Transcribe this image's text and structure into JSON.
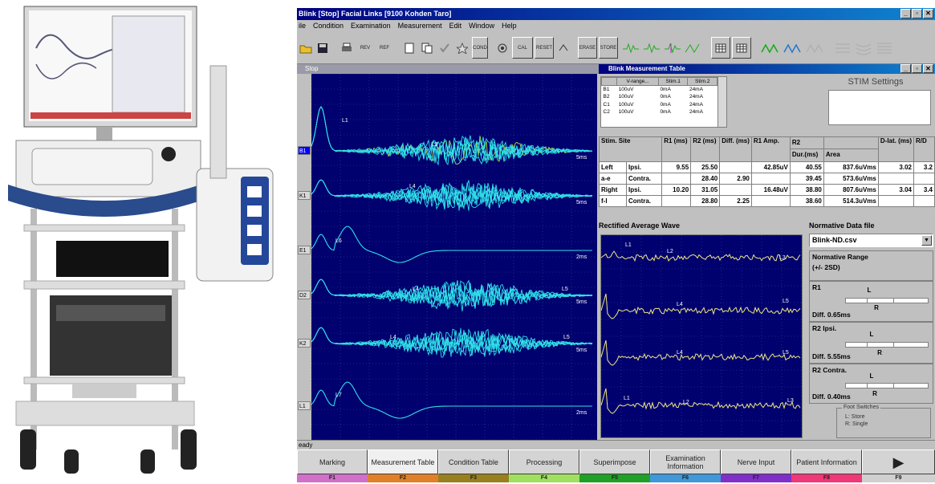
{
  "window": {
    "title": "Blink  [Stop]  Facial  Links [9100  Kohden  Taro]",
    "min": "_",
    "max": "▫",
    "close": "✕"
  },
  "menu": [
    "ile",
    "Condition",
    "Examination",
    "Measurement",
    "Edit",
    "Window",
    "Help"
  ],
  "toolbar": {
    "rev_label": "REV",
    "ref_label": "REF",
    "cond_label": "COND",
    "cal_label": "CAL",
    "reset_label": "RESET",
    "erase_label": "ERASE",
    "store_label": "STORE",
    "meas_label": "MEAS"
  },
  "wave_window": {
    "title": "Stop",
    "channels": [
      "B1",
      "K1",
      "E1",
      "D2",
      "K2",
      "L1"
    ],
    "selected_channel": "B1",
    "scales": [
      "5ms",
      "5ms",
      "2ms",
      "5ms",
      "5ms",
      "2ms"
    ],
    "markers": [
      "L1",
      "L2",
      "L4",
      "L6",
      "L4",
      "L5",
      "L4",
      "L5",
      "L7"
    ]
  },
  "measurement_table": {
    "title": "Blink Measurement Table",
    "stim_settings_label": "STIM Settings",
    "settings_headers": [
      "",
      "V-range...",
      "Stim.1",
      "Stim.2"
    ],
    "settings_rows": [
      [
        "B1",
        "100uV",
        "0mA",
        "24mA"
      ],
      [
        "B2",
        "100uV",
        "0mA",
        "24mA"
      ],
      [
        "C1",
        "100uV",
        "0mA",
        "24mA"
      ],
      [
        "C2",
        "100uV",
        "0mA",
        "24mA"
      ]
    ],
    "headers": {
      "stim_site": "Stim. Site",
      "r1_ms": "R1 (ms)",
      "r2_ms": "R2 (ms)",
      "diff": "Diff. (ms)",
      "r1_amp": "R1 Amp.",
      "r2": "R2",
      "dur": "Dur.(ms)",
      "area": "Area",
      "dlat": "D-lat. (ms)",
      "rd": "R/D"
    },
    "rows": [
      {
        "side": "Left",
        "site": "Ipsi.",
        "r1": "9.55",
        "r2": "25.50",
        "diff": "",
        "amp": "42.85uV",
        "dur": "40.55",
        "area": "837.6uVms",
        "dlat": "3.02",
        "rd": "3.2"
      },
      {
        "side": "a-e",
        "site": "Contra.",
        "r1": "",
        "r2": "28.40",
        "diff": "2.90",
        "amp": "",
        "dur": "39.45",
        "area": "573.6uVms",
        "dlat": "",
        "rd": ""
      },
      {
        "side": "Right",
        "site": "Ipsi.",
        "r1": "10.20",
        "r2": "31.05",
        "diff": "",
        "amp": "16.48uV",
        "dur": "38.80",
        "area": "807.6uVms",
        "dlat": "3.04",
        "rd": "3.4"
      },
      {
        "side": "f-l",
        "site": "Contra.",
        "r1": "",
        "r2": "28.80",
        "diff": "2.25",
        "amp": "",
        "dur": "38.60",
        "area": "514.3uVms",
        "dlat": "",
        "rd": ""
      }
    ]
  },
  "rectified": {
    "title": "Rectified Average Wave",
    "markers": [
      "L1",
      "L2",
      "L3",
      "L4",
      "L5",
      "L4",
      "L5",
      "L1",
      "L2",
      "L3"
    ]
  },
  "normative": {
    "title": "Normative Data file",
    "file": "Blink-ND.csv",
    "range_title": "Normative Range",
    "range_sub": "(+/- 2SD)",
    "groups": [
      {
        "name": "R1",
        "diff": "Diff. 0.65ms"
      },
      {
        "name": "R2 Ipsi.",
        "diff": "Diff. 5.55ms"
      },
      {
        "name": "R2 Contra.",
        "diff": "Diff. 0.40ms"
      }
    ],
    "marker_l": "L",
    "marker_r": "R"
  },
  "foot_switches": {
    "title": "Foot Switches",
    "store": "L: Store",
    "single": "R: Single"
  },
  "status": "eady",
  "fkeys": [
    {
      "label": "Marking",
      "num": "F1",
      "color": "#d070c8"
    },
    {
      "label": "Measurement Table",
      "num": "F2",
      "color": "#e08028"
    },
    {
      "label": "Condition Table",
      "num": "F3",
      "color": "#988020"
    },
    {
      "label": "Processing",
      "num": "F4",
      "color": "#a0e060"
    },
    {
      "label": "Superimpose",
      "num": "F5",
      "color": "#20a028"
    },
    {
      "label": "Examination Information",
      "num": "F6",
      "color": "#4098d8"
    },
    {
      "label": "Nerve Input",
      "num": "F7",
      "color": "#8030c8"
    },
    {
      "label": "Patient Information",
      "num": "F8",
      "color": "#f03878"
    },
    {
      "label": "▶",
      "num": "F9",
      "color": "#d0d0d0"
    }
  ]
}
